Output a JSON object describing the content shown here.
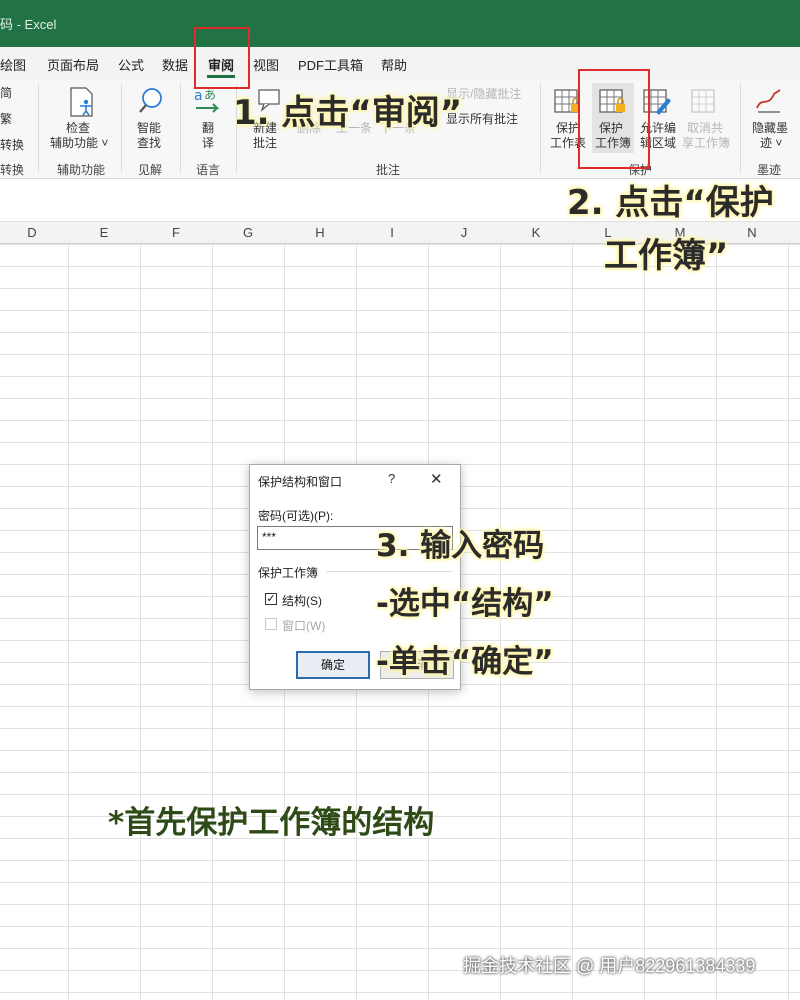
{
  "app": {
    "title": "码 - Excel"
  },
  "menu": {
    "tabs": [
      "绘图",
      "页面布局",
      "公式",
      "数据",
      "审阅",
      "视图",
      "PDF工具箱",
      "帮助"
    ],
    "active": "审阅"
  },
  "ribbon": {
    "left_partial": [
      "简",
      "繁",
      "转换",
      "转换"
    ],
    "accessibility": {
      "label1": "检查",
      "label2": "辅助功能 ˅",
      "group": "辅助功能"
    },
    "insights": {
      "label1": "智能",
      "label2": "查找",
      "group": "见解"
    },
    "language": {
      "label1": "翻",
      "label2": "译",
      "group": "语言"
    },
    "comments": {
      "new_1": "新建",
      "new_2": "批注",
      "delete": "删除",
      "prev": "上一条",
      "next": "下一条",
      "show_hide": "显示/隐藏批注",
      "show_all": "显示所有批注",
      "group": "批注"
    },
    "protect": {
      "sheet_1": "保护",
      "sheet_2": "工作表",
      "workbook_1": "保护",
      "workbook_2": "工作簿",
      "ranges_1": "允许编",
      "ranges_2": "辑区域",
      "unshare_1": "取消共",
      "unshare_2": "享工作簿",
      "group": "保护"
    },
    "ink": {
      "label1": "隐藏墨",
      "label2": "迹 ˅",
      "group": "墨迹"
    }
  },
  "columns": [
    "D",
    "E",
    "F",
    "G",
    "H",
    "I",
    "J",
    "K",
    "L",
    "M",
    "N"
  ],
  "dialog": {
    "title": "保护结构和窗口",
    "help": "?",
    "close": "✕",
    "password_label": "密码(可选)(P):",
    "password_value": "***",
    "section": "保护工作簿",
    "structure_label": "结构(S)",
    "structure_checked": "✓",
    "windows_label": "窗口(W)",
    "ok": "确定",
    "cancel": "取消"
  },
  "annotations": {
    "step1": "1. 点击“审阅”",
    "step2_line1": "2. 点击“保护",
    "step2_line2": "工作簿”",
    "step3_line1": "3. 输入密码",
    "step3_line2": "-选中“结构”",
    "step3_line3": "-单击“确定”"
  },
  "note": "*首先保护工作簿的结构",
  "watermark": "掘金技术社区 @ 用户822961384339",
  "colors": {
    "excel_green": "#217346",
    "highlight_red": "#e02b2b",
    "annotation_glow": "#fff6b0",
    "note_green": "#2e4a16"
  }
}
